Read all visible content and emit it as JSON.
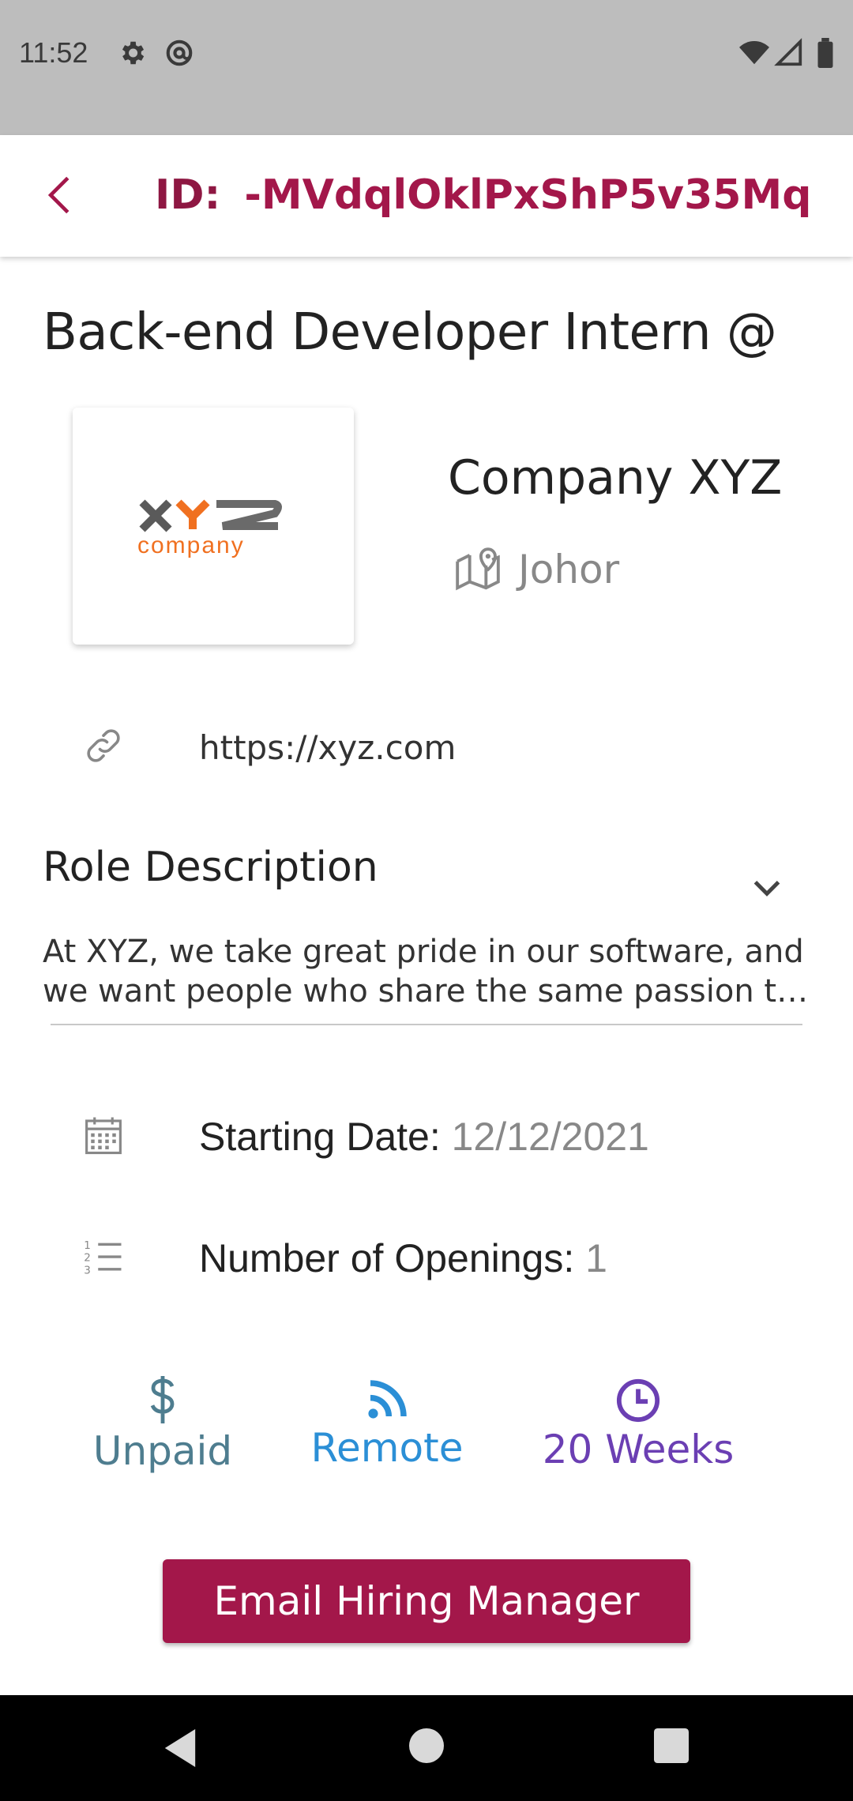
{
  "status_bar": {
    "time": "11:52"
  },
  "app_bar": {
    "id_label": "ID:",
    "id_value": "-MVdqlOklPxShP5v35Mq"
  },
  "job": {
    "title": "Back-end Developer Intern @",
    "logo_text_main": "XYZ",
    "logo_text_sub": "company",
    "company_name": "Company XYZ",
    "location": "Johor",
    "url": "https://xyz.com"
  },
  "role": {
    "heading": "Role Description",
    "description_line1": "At XYZ, we take great pride in our software, and",
    "description_line2": "we want people who share the same passion to..."
  },
  "details": {
    "start_label": "Starting Date:",
    "start_value": "12/12/2021",
    "openings_label": "Number of Openings:",
    "openings_value": "1"
  },
  "tags": [
    {
      "label": "Unpaid",
      "icon": "dollar-icon",
      "color": "#4e7d8f"
    },
    {
      "label": "Remote",
      "icon": "rss-icon",
      "color": "#2b8fd6"
    },
    {
      "label": "20 Weeks",
      "icon": "clock-icon",
      "color": "#6b3fb3"
    }
  ],
  "actions": {
    "email_label": "Email Hiring Manager"
  },
  "colors": {
    "accent": "#a3174a",
    "status_bar": "#bdbdbd"
  }
}
